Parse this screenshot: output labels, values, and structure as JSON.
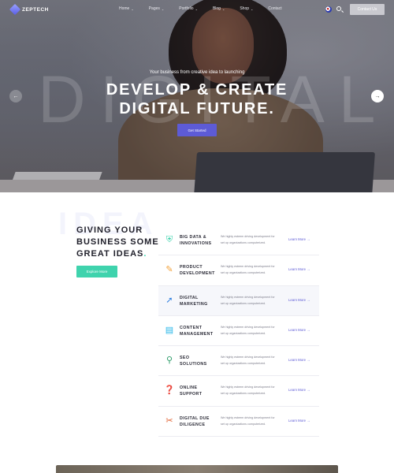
{
  "nav": {
    "logo": "ZEPTECH",
    "menu": [
      {
        "label": "Home"
      },
      {
        "label": "Pages"
      },
      {
        "label": "Portfolio"
      },
      {
        "label": "Blog"
      },
      {
        "label": "Shop"
      },
      {
        "label": "Contact"
      }
    ],
    "contact_button": "Contact Us"
  },
  "hero": {
    "watermark": "DIGITAL",
    "eyebrow": "Your business from creative idea to launching",
    "headline_line1": "DEVELOP & CREATE",
    "headline_line2": "DIGITAL FUTURE.",
    "cta": "Get Started",
    "prev_arrow": "←",
    "next_arrow": "→"
  },
  "services_section": {
    "watermark": "IDEA",
    "title": "GIVING YOUR BUSINESS SOME GREAT IDEAS",
    "title_dot": ".",
    "cta": "Explore More",
    "link_label": "Learn More →",
    "items": [
      {
        "title": "BIG DATA & INNOVATIONS",
        "icon": "shield-check-icon",
        "desc": "We highly esteem driving development for set up organizations computerized."
      },
      {
        "title": "PRODUCT DEVELOPMENT",
        "icon": "pencil-icon",
        "desc": "We highly esteem driving development for set up organizations computerized."
      },
      {
        "title": "DIGITAL MARKETING",
        "icon": "cursor-icon",
        "desc": "We highly esteem driving development for set up organizations computerized."
      },
      {
        "title": "CONTENT MANAGEMENT",
        "icon": "chat-icon",
        "desc": "We highly esteem driving development for set up organizations computerized."
      },
      {
        "title": "SEO SOLUTIONS",
        "icon": "magnifier-icon",
        "desc": "We highly esteem driving development for set up organizations computerized."
      },
      {
        "title": "ONLINE SUPPORT",
        "icon": "question-icon",
        "desc": "We highly esteem driving development for set up organizations computerized."
      },
      {
        "title": "DIGITAL DUE DILIGENCE",
        "icon": "tools-icon",
        "desc": "We highly esteem driving development for set up organizations computerized."
      }
    ]
  },
  "colors": {
    "accent": "#5d5bd6",
    "mint": "#3fd3ad",
    "heading": "#1f1f2a"
  }
}
